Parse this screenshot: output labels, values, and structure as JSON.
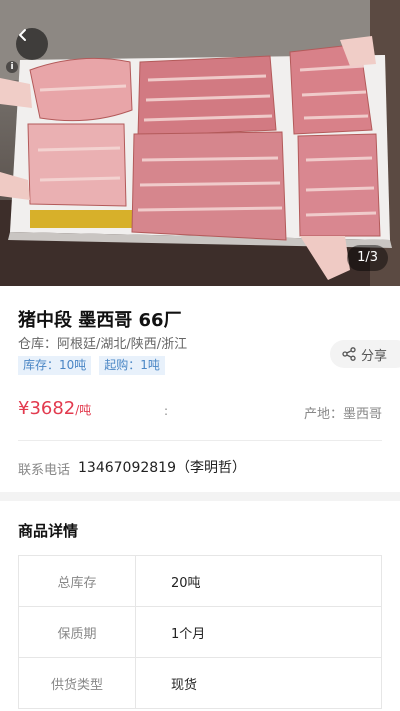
{
  "hero": {
    "counter": "1/3"
  },
  "product": {
    "title": "猪中段 墨西哥 66厂",
    "warehouse": "仓库：阿根廷/湖北/陕西/浙江",
    "tags": [
      "库存：10吨",
      "起购：1吨"
    ],
    "share_label": "分享",
    "price": "¥3682",
    "price_unit": "/吨",
    "colon": ":",
    "origin": "产地：墨西哥",
    "contact_label": "联系电话",
    "contact_value": "13467092819（李明哲）"
  },
  "details": {
    "section_title": "商品详情",
    "rows": [
      {
        "key": "总库存",
        "value": "20吨"
      },
      {
        "key": "保质期",
        "value": "1个月"
      },
      {
        "key": "供货类型",
        "value": "现货"
      }
    ]
  },
  "colors": {
    "price": "#e23a4e",
    "tag_text": "#4a86c5",
    "tag_bg": "#e8f1fb"
  }
}
